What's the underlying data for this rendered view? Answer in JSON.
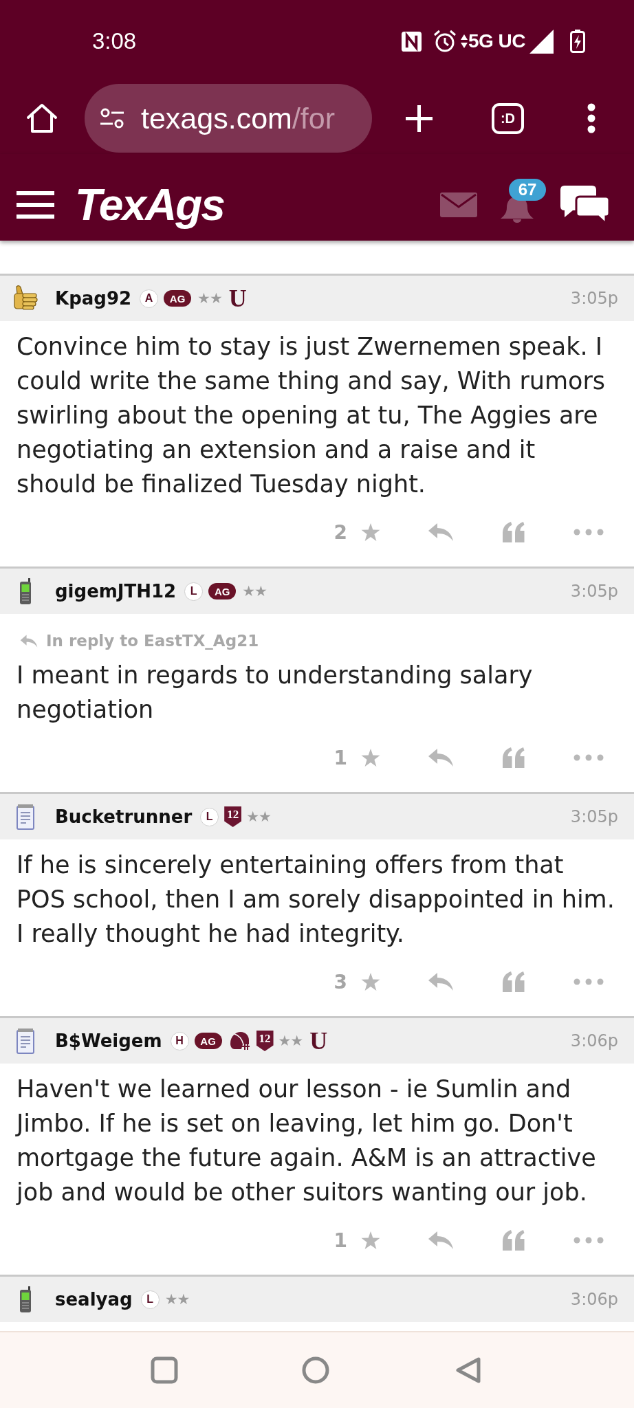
{
  "status_bar": {
    "time": "3:08",
    "network": "5G UC"
  },
  "browser": {
    "url_host": "texags.com",
    "url_path": "/for",
    "tab_count": ":D"
  },
  "site_header": {
    "logo": "TexAgs",
    "notification_count": "67"
  },
  "posts": [
    {
      "avatar": {
        "kind": "thumbs"
      },
      "username": "Kpag92",
      "badges": [
        {
          "kind": "circle",
          "text": "A"
        },
        {
          "kind": "pill",
          "text": "AG"
        },
        {
          "kind": "stars",
          "text": "★★"
        },
        {
          "kind": "letter",
          "text": "U"
        }
      ],
      "time": "3:05p",
      "body": "Convince him to stay is just Zwernemen speak. I could write the same thing and say, With rumors swirling about the opening at tu, The Aggies are negotiating an extension and a raise and it should be finalized Tuesday night.",
      "votes": "2"
    },
    {
      "avatar": {
        "kind": "phone"
      },
      "username": "gigemJTH12",
      "badges": [
        {
          "kind": "circle",
          "text": "L"
        },
        {
          "kind": "pill",
          "text": "AG"
        },
        {
          "kind": "stars",
          "text": "★★"
        }
      ],
      "time": "3:05p",
      "in_reply_to": "In reply to EastTX_Ag21",
      "body": "I meant in regards to understanding salary negotiation",
      "votes": "1"
    },
    {
      "avatar": {
        "kind": "notepad"
      },
      "username": "Bucketrunner",
      "badges": [
        {
          "kind": "circle",
          "text": "L"
        },
        {
          "kind": "shield",
          "text": "12"
        },
        {
          "kind": "stars",
          "text": "★★"
        }
      ],
      "time": "3:05p",
      "body": "If he is sincerely entertaining offers from that POS school, then I am sorely disappointed in him. I really thought he had integrity.",
      "votes": "3"
    },
    {
      "avatar": {
        "kind": "notepad"
      },
      "username": "B$Weigem",
      "badges": [
        {
          "kind": "circle",
          "text": "H"
        },
        {
          "kind": "pill",
          "text": "AG"
        },
        {
          "kind": "helmet"
        },
        {
          "kind": "shield",
          "text": "12"
        },
        {
          "kind": "stars",
          "text": "★★"
        },
        {
          "kind": "letter",
          "text": "U"
        }
      ],
      "time": "3:06p",
      "body": "Haven't we learned our lesson - ie Sumlin and Jimbo. If he is set on leaving, let him go. Don't mortgage the future again. A&M is an attractive job and would be other suitors wanting our job.",
      "votes": "1"
    },
    {
      "avatar": {
        "kind": "phone"
      },
      "username": "sealyag",
      "badges": [
        {
          "kind": "circle",
          "text": "L"
        },
        {
          "kind": "stars",
          "text": "★★"
        }
      ],
      "time": "3:06p"
    }
  ]
}
